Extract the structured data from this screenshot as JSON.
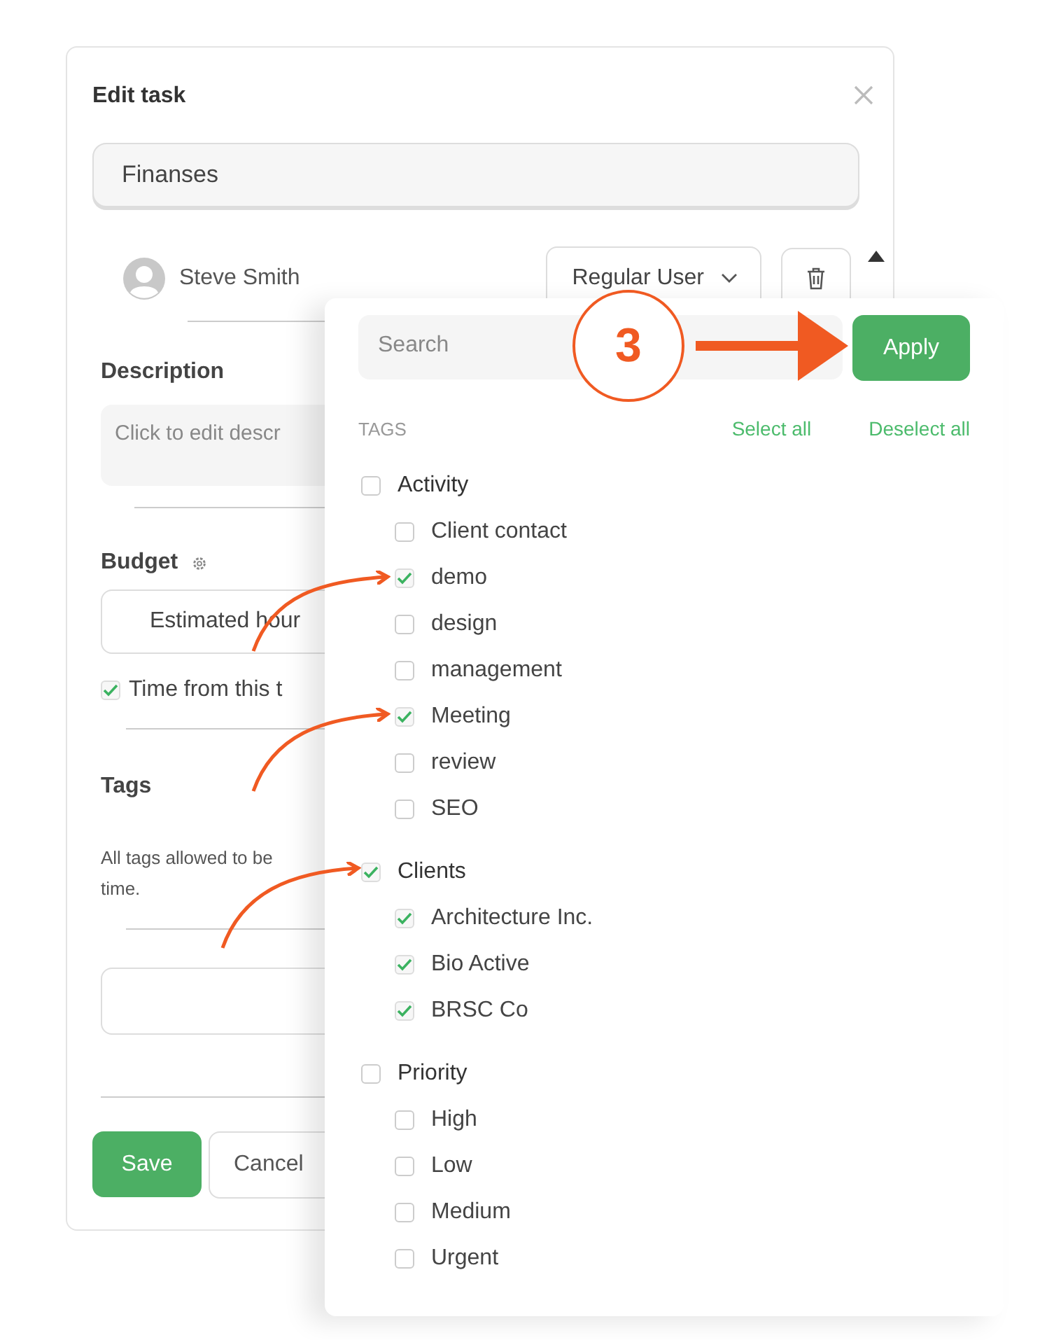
{
  "dialog": {
    "title": "Edit task",
    "task_name": "Finanses",
    "assignee": {
      "name": "Steve Smith",
      "role": "Regular User"
    },
    "description_label": "Description",
    "description_placeholder": "Click to edit descr",
    "budget_label": "Budget",
    "budget_field": "Estimated hour",
    "time_option": {
      "label": "Time from this t",
      "checked": true
    },
    "tags_label": "Tags",
    "tags_hint": [
      "All tags allowed to be",
      "time."
    ],
    "buttons": [
      {
        "label": "Save",
        "kind": "primary"
      },
      {
        "label": "Cancel",
        "kind": "secondary"
      }
    ]
  },
  "tag_popup": {
    "search": {
      "placeholder": "Search"
    },
    "apply": "Apply",
    "heading": "TAGS",
    "select_all": "Select all",
    "deselect_all": "Deselect all",
    "groups": [
      {
        "name": "Activity",
        "checked": false,
        "children": [
          {
            "name": "Client contact",
            "checked": false
          },
          {
            "name": "demo",
            "checked": true
          },
          {
            "name": "design",
            "checked": false
          },
          {
            "name": "management",
            "checked": false
          },
          {
            "name": "Meeting",
            "checked": true
          },
          {
            "name": "review",
            "checked": false
          },
          {
            "name": "SEO",
            "checked": false
          }
        ]
      },
      {
        "name": "Clients",
        "checked": true,
        "children": [
          {
            "name": "Architecture Inc.",
            "checked": true
          },
          {
            "name": "Bio Active",
            "checked": true
          },
          {
            "name": "BRSC Co",
            "checked": true
          }
        ]
      },
      {
        "name": "Priority",
        "checked": false,
        "children": [
          {
            "name": "High",
            "checked": false
          },
          {
            "name": "Low",
            "checked": false
          },
          {
            "name": "Medium",
            "checked": false
          },
          {
            "name": "Urgent",
            "checked": false
          }
        ]
      }
    ]
  },
  "annotation": {
    "step": "3"
  }
}
